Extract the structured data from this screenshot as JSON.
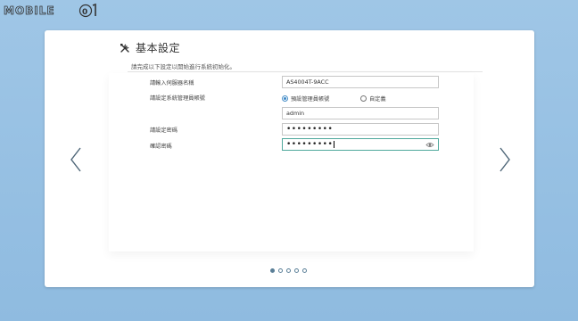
{
  "watermark": {
    "text": "MOBILE01"
  },
  "page": {
    "title": "基本設定",
    "subtitle": "請完成以下設定以開始進行系統初始化。"
  },
  "form": {
    "server_name": {
      "label": "請輸入伺服器名稱",
      "value": "AS4004T-9ACC"
    },
    "admin_account": {
      "label": "請設定系統管理員帳號",
      "options": [
        {
          "label": "預設管理員帳號",
          "checked": true
        },
        {
          "label": "自定義",
          "checked": false
        }
      ],
      "value": "admin"
    },
    "password": {
      "label": "請設定密碼",
      "value": "•••••••••"
    },
    "confirm_password": {
      "label": "確認密碼",
      "value": "•••••••••"
    }
  },
  "navigation": {
    "prev_icon": "chevron-left-icon",
    "next_icon": "chevron-right-icon",
    "pages": 5,
    "current_page": 1
  },
  "colors": {
    "background": "#9fc6e6",
    "focus_border": "#4fa89c",
    "radio_checked": "#3a86c6",
    "pager": "#5a7f97"
  }
}
